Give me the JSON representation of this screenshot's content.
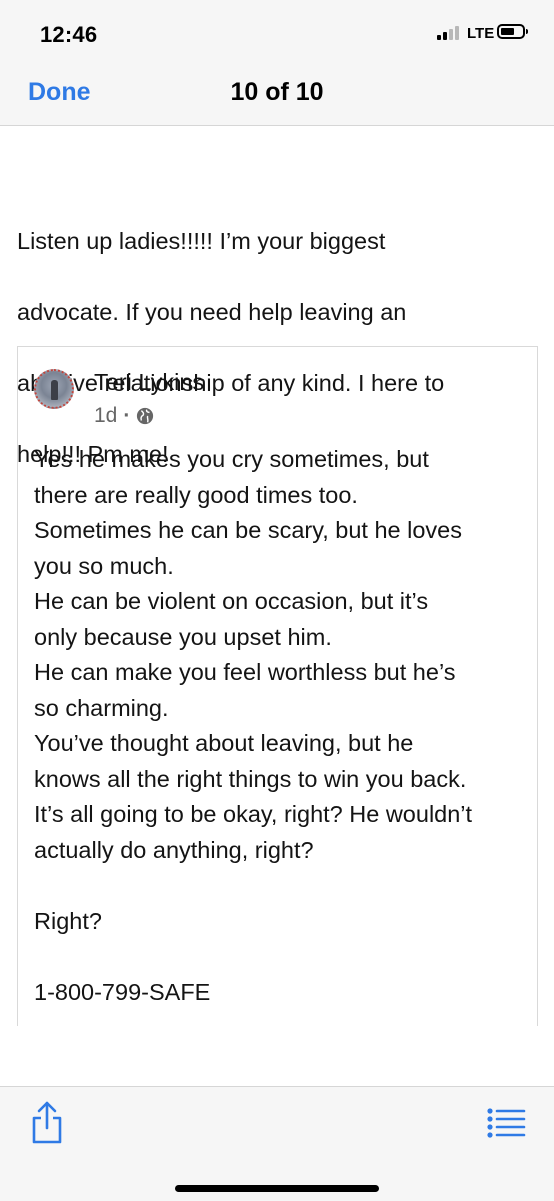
{
  "status_bar": {
    "time": "12:46",
    "network": "LTE"
  },
  "nav": {
    "done_label": "Done",
    "title": "10 of 10"
  },
  "post": {
    "text_lines": [
      "Listen up ladies!!!!!  I’m your biggest",
      "advocate.  If you need help leaving an",
      "abusive relationship of any kind. I  here to",
      "help!!! Pm me!"
    ]
  },
  "shared_post": {
    "author": "Teri Lykins",
    "time": "1d",
    "separator": "·",
    "audience_icon": "globe-icon",
    "lines": [
      "Yes he makes you cry sometimes, but",
      "there are really good times too.",
      "Sometimes he can be scary, but he loves",
      "you so much.",
      "He can be violent on occasion, but it’s",
      "only because you upset him.",
      "He can make you feel worthless but he’s",
      "so charming.",
      "You’ve thought about leaving, but he",
      "knows all the right things to win you back.",
      "It’s all going to be okay, right? He wouldn’t",
      "actually do anything, right?",
      "",
      "Right?",
      "",
      "1-800-799-SAFE"
    ]
  },
  "toolbar": {
    "share_icon": "share-icon",
    "list_icon": "list-icon"
  },
  "colors": {
    "accent": "#2f7ae5",
    "bar_background": "#f6f6f6",
    "text": "#141414",
    "muted": "#666666"
  }
}
